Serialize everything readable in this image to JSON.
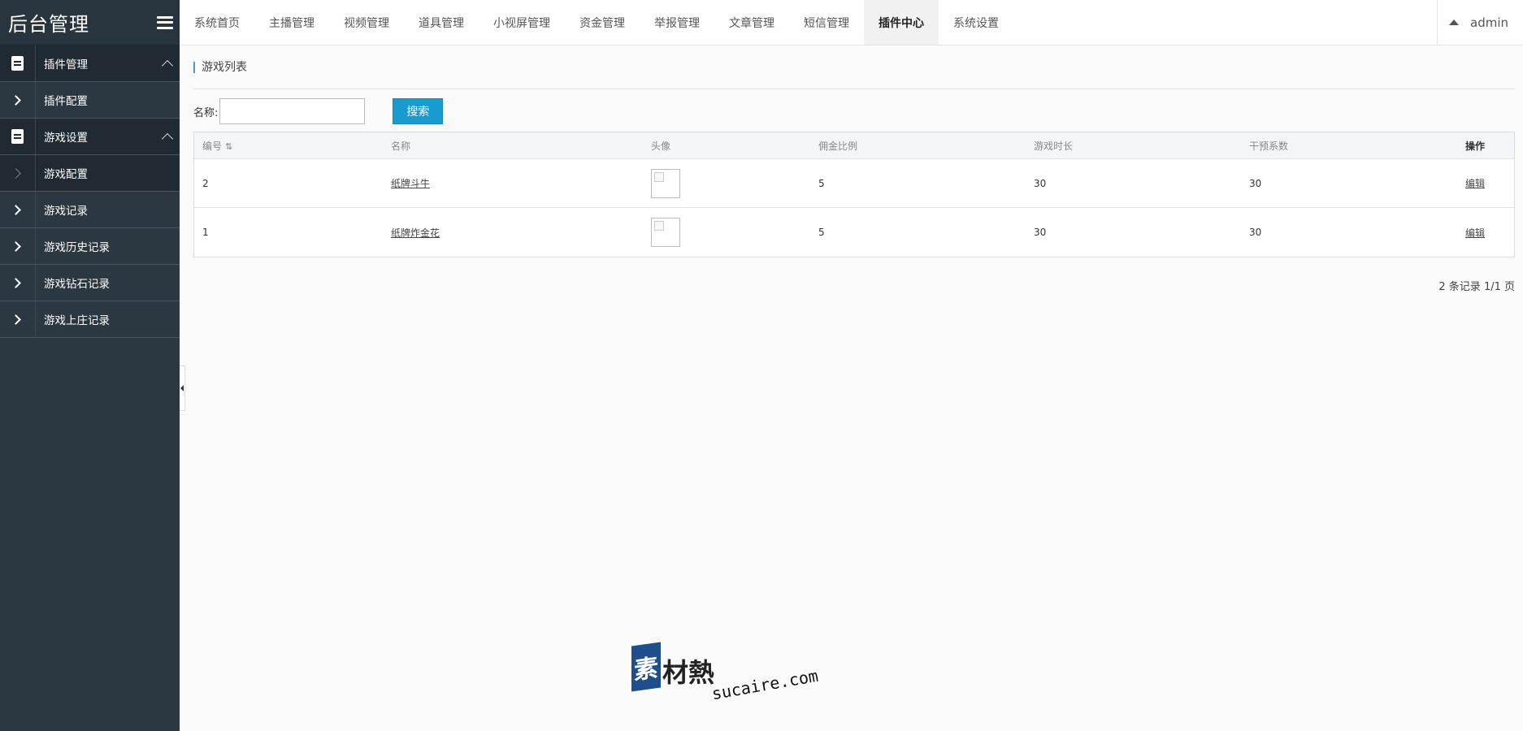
{
  "brand": {
    "title": "后台管理"
  },
  "top_nav": {
    "tabs": [
      "系统首页",
      "主播管理",
      "视频管理",
      "道具管理",
      "小视屏管理",
      "资金管理",
      "举报管理",
      "文章管理",
      "短信管理",
      "插件中心",
      "系统设置"
    ],
    "active": "插件中心",
    "user": "admin"
  },
  "sidebar": {
    "items": [
      {
        "label": "插件管理",
        "type": "group",
        "icon": "document-icon",
        "expanded": true
      },
      {
        "label": "插件配置",
        "type": "sub"
      },
      {
        "label": "游戏设置",
        "type": "group",
        "icon": "document-icon",
        "expanded": true
      },
      {
        "label": "游戏配置",
        "type": "sub",
        "active": true
      },
      {
        "label": "游戏记录",
        "type": "sub"
      },
      {
        "label": "游戏历史记录",
        "type": "sub"
      },
      {
        "label": "游戏钻石记录",
        "type": "sub"
      },
      {
        "label": "游戏上庄记录",
        "type": "sub"
      }
    ]
  },
  "main": {
    "section_title": "游戏列表",
    "search": {
      "label": "名称:",
      "value": "",
      "button": "搜索"
    },
    "table": {
      "headers": [
        "编号",
        "名称",
        "头像",
        "佣金比例",
        "游戏时长",
        "干预系数",
        "操作"
      ],
      "rows": [
        {
          "id": "2",
          "name": "纸牌斗牛",
          "commission": "5",
          "duration": "30",
          "coefficient": "30",
          "action": "编辑"
        },
        {
          "id": "1",
          "name": "纸牌炸金花",
          "commission": "5",
          "duration": "30",
          "coefficient": "30",
          "action": "编辑"
        }
      ]
    },
    "pagination": "2 条记录 1/1 页"
  },
  "watermark": {
    "char": "素",
    "text": "材熱",
    "url": "sucaire.com"
  },
  "colors": {
    "sidebar_bg": "#2b3842",
    "accent": "#1a9bd0",
    "page_bg": "#fafafa"
  }
}
